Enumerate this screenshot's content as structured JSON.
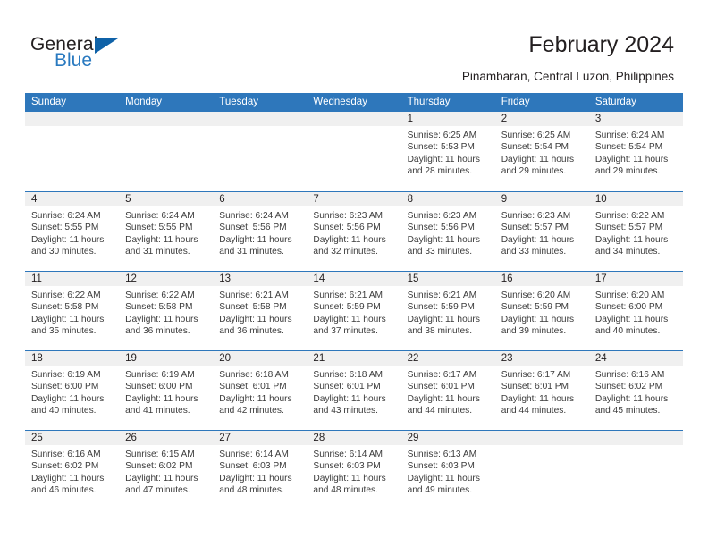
{
  "brand": {
    "name_part1": "General",
    "name_part2": "Blue"
  },
  "header": {
    "title": "February 2024",
    "subtitle": "Pinambaran, Central Luzon, Philippines"
  },
  "colors": {
    "header_blue": "#2e77bb",
    "brand_blue": "#2a7ac0",
    "logo_triangle": "#0f62a8",
    "daynum_band": "#f0f0f0",
    "text": "#231f20"
  },
  "weekday_headers": [
    "Sunday",
    "Monday",
    "Tuesday",
    "Wednesday",
    "Thursday",
    "Friday",
    "Saturday"
  ],
  "labels": {
    "sunrise": "Sunrise:",
    "sunset": "Sunset:",
    "daylight": "Daylight:"
  },
  "weeks": [
    [
      {
        "day": "",
        "sunrise": "",
        "sunset": "",
        "daylight": ""
      },
      {
        "day": "",
        "sunrise": "",
        "sunset": "",
        "daylight": ""
      },
      {
        "day": "",
        "sunrise": "",
        "sunset": "",
        "daylight": ""
      },
      {
        "day": "",
        "sunrise": "",
        "sunset": "",
        "daylight": ""
      },
      {
        "day": "1",
        "sunrise": "Sunrise: 6:25 AM",
        "sunset": "Sunset: 5:53 PM",
        "daylight": "Daylight: 11 hours and 28 minutes."
      },
      {
        "day": "2",
        "sunrise": "Sunrise: 6:25 AM",
        "sunset": "Sunset: 5:54 PM",
        "daylight": "Daylight: 11 hours and 29 minutes."
      },
      {
        "day": "3",
        "sunrise": "Sunrise: 6:24 AM",
        "sunset": "Sunset: 5:54 PM",
        "daylight": "Daylight: 11 hours and 29 minutes."
      }
    ],
    [
      {
        "day": "4",
        "sunrise": "Sunrise: 6:24 AM",
        "sunset": "Sunset: 5:55 PM",
        "daylight": "Daylight: 11 hours and 30 minutes."
      },
      {
        "day": "5",
        "sunrise": "Sunrise: 6:24 AM",
        "sunset": "Sunset: 5:55 PM",
        "daylight": "Daylight: 11 hours and 31 minutes."
      },
      {
        "day": "6",
        "sunrise": "Sunrise: 6:24 AM",
        "sunset": "Sunset: 5:56 PM",
        "daylight": "Daylight: 11 hours and 31 minutes."
      },
      {
        "day": "7",
        "sunrise": "Sunrise: 6:23 AM",
        "sunset": "Sunset: 5:56 PM",
        "daylight": "Daylight: 11 hours and 32 minutes."
      },
      {
        "day": "8",
        "sunrise": "Sunrise: 6:23 AM",
        "sunset": "Sunset: 5:56 PM",
        "daylight": "Daylight: 11 hours and 33 minutes."
      },
      {
        "day": "9",
        "sunrise": "Sunrise: 6:23 AM",
        "sunset": "Sunset: 5:57 PM",
        "daylight": "Daylight: 11 hours and 33 minutes."
      },
      {
        "day": "10",
        "sunrise": "Sunrise: 6:22 AM",
        "sunset": "Sunset: 5:57 PM",
        "daylight": "Daylight: 11 hours and 34 minutes."
      }
    ],
    [
      {
        "day": "11",
        "sunrise": "Sunrise: 6:22 AM",
        "sunset": "Sunset: 5:58 PM",
        "daylight": "Daylight: 11 hours and 35 minutes."
      },
      {
        "day": "12",
        "sunrise": "Sunrise: 6:22 AM",
        "sunset": "Sunset: 5:58 PM",
        "daylight": "Daylight: 11 hours and 36 minutes."
      },
      {
        "day": "13",
        "sunrise": "Sunrise: 6:21 AM",
        "sunset": "Sunset: 5:58 PM",
        "daylight": "Daylight: 11 hours and 36 minutes."
      },
      {
        "day": "14",
        "sunrise": "Sunrise: 6:21 AM",
        "sunset": "Sunset: 5:59 PM",
        "daylight": "Daylight: 11 hours and 37 minutes."
      },
      {
        "day": "15",
        "sunrise": "Sunrise: 6:21 AM",
        "sunset": "Sunset: 5:59 PM",
        "daylight": "Daylight: 11 hours and 38 minutes."
      },
      {
        "day": "16",
        "sunrise": "Sunrise: 6:20 AM",
        "sunset": "Sunset: 5:59 PM",
        "daylight": "Daylight: 11 hours and 39 minutes."
      },
      {
        "day": "17",
        "sunrise": "Sunrise: 6:20 AM",
        "sunset": "Sunset: 6:00 PM",
        "daylight": "Daylight: 11 hours and 40 minutes."
      }
    ],
    [
      {
        "day": "18",
        "sunrise": "Sunrise: 6:19 AM",
        "sunset": "Sunset: 6:00 PM",
        "daylight": "Daylight: 11 hours and 40 minutes."
      },
      {
        "day": "19",
        "sunrise": "Sunrise: 6:19 AM",
        "sunset": "Sunset: 6:00 PM",
        "daylight": "Daylight: 11 hours and 41 minutes."
      },
      {
        "day": "20",
        "sunrise": "Sunrise: 6:18 AM",
        "sunset": "Sunset: 6:01 PM",
        "daylight": "Daylight: 11 hours and 42 minutes."
      },
      {
        "day": "21",
        "sunrise": "Sunrise: 6:18 AM",
        "sunset": "Sunset: 6:01 PM",
        "daylight": "Daylight: 11 hours and 43 minutes."
      },
      {
        "day": "22",
        "sunrise": "Sunrise: 6:17 AM",
        "sunset": "Sunset: 6:01 PM",
        "daylight": "Daylight: 11 hours and 44 minutes."
      },
      {
        "day": "23",
        "sunrise": "Sunrise: 6:17 AM",
        "sunset": "Sunset: 6:01 PM",
        "daylight": "Daylight: 11 hours and 44 minutes."
      },
      {
        "day": "24",
        "sunrise": "Sunrise: 6:16 AM",
        "sunset": "Sunset: 6:02 PM",
        "daylight": "Daylight: 11 hours and 45 minutes."
      }
    ],
    [
      {
        "day": "25",
        "sunrise": "Sunrise: 6:16 AM",
        "sunset": "Sunset: 6:02 PM",
        "daylight": "Daylight: 11 hours and 46 minutes."
      },
      {
        "day": "26",
        "sunrise": "Sunrise: 6:15 AM",
        "sunset": "Sunset: 6:02 PM",
        "daylight": "Daylight: 11 hours and 47 minutes."
      },
      {
        "day": "27",
        "sunrise": "Sunrise: 6:14 AM",
        "sunset": "Sunset: 6:03 PM",
        "daylight": "Daylight: 11 hours and 48 minutes."
      },
      {
        "day": "28",
        "sunrise": "Sunrise: 6:14 AM",
        "sunset": "Sunset: 6:03 PM",
        "daylight": "Daylight: 11 hours and 48 minutes."
      },
      {
        "day": "29",
        "sunrise": "Sunrise: 6:13 AM",
        "sunset": "Sunset: 6:03 PM",
        "daylight": "Daylight: 11 hours and 49 minutes."
      },
      {
        "day": "",
        "sunrise": "",
        "sunset": "",
        "daylight": ""
      },
      {
        "day": "",
        "sunrise": "",
        "sunset": "",
        "daylight": ""
      }
    ]
  ]
}
